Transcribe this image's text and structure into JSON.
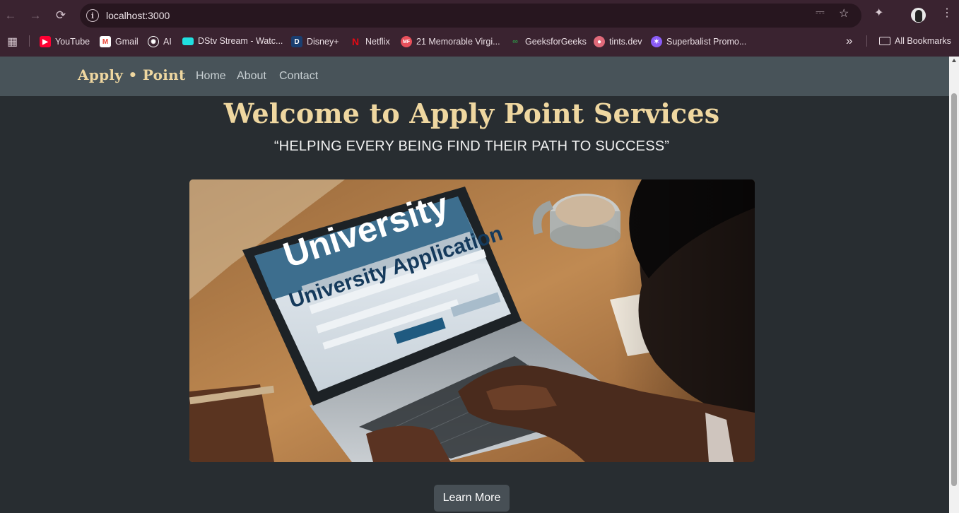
{
  "browser": {
    "url": "localhost:3000",
    "back_icon": "arrow-left-icon",
    "forward_icon": "arrow-right-icon",
    "reload_icon": "reload-icon",
    "bookmarks": [
      {
        "label": "YouTube",
        "icon": "youtube-icon",
        "color": "#ff0033"
      },
      {
        "label": "Gmail",
        "icon": "gmail-icon",
        "color": "#ea4335"
      },
      {
        "label": "AI",
        "icon": "openai-icon",
        "color": "#ffffff"
      },
      {
        "label": "DStv Stream - Watc...",
        "icon": "dstv-icon",
        "color": "#20e0e0"
      },
      {
        "label": "Disney+",
        "icon": "disney-icon",
        "color": "#1a6fb0"
      },
      {
        "label": "Netflix",
        "icon": "netflix-icon",
        "color": "#e50914"
      },
      {
        "label": "21 Memorable Virgi...",
        "icon": "mf-icon",
        "color": "#e8505b"
      },
      {
        "label": "GeeksforGeeks",
        "icon": "gfg-icon",
        "color": "#2f8d46"
      },
      {
        "label": "tints.dev",
        "icon": "tints-icon",
        "color": "#e06a7a"
      },
      {
        "label": "Superbalist Promo...",
        "icon": "superbalist-icon",
        "color": "#8a5cf6"
      }
    ],
    "all_bookmarks_label": "All Bookmarks",
    "overflow_label": "»"
  },
  "site": {
    "logo": "Apply • Point",
    "nav": [
      {
        "label": "Home"
      },
      {
        "label": "About"
      },
      {
        "label": "Contact"
      }
    ],
    "hero_title": "Welcome to Apply Point Services",
    "hero_subtitle": "“HELPING EVERY BEING FIND THEIR PATH TO SUCCESS”",
    "image_text_large": "University",
    "image_text_small": "University Application",
    "cta_label": "Learn More"
  },
  "colors": {
    "accent": "#efd7a0",
    "page_bg": "#282d31",
    "nav_bg": "#485359",
    "chrome_bg": "#3a2330"
  }
}
